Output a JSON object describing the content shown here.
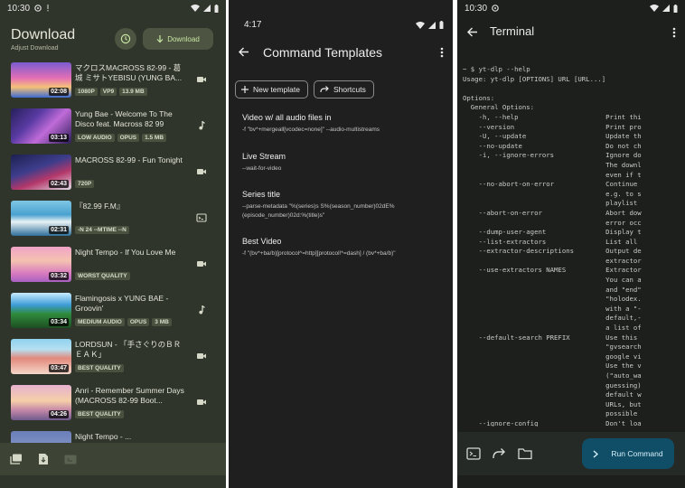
{
  "phone1": {
    "status_time": "10:30",
    "title": "Download",
    "subtitle": "Adjust Download",
    "download_button_label": "Download",
    "items": [
      {
        "title": "マクロスMACROSS 82-99 - 葛城 ミサトYEBISU (YUNG BA...",
        "duration": "02:08",
        "tags": [
          "1080P",
          "VP9",
          "13.9 MB"
        ],
        "type": "video"
      },
      {
        "title": "Yung Bae - Welcome To The Disco feat. Macross 82 99",
        "duration": "03:13",
        "tags": [
          "LOW AUDIO",
          "OPUS",
          "1.5 MB"
        ],
        "type": "audio"
      },
      {
        "title": "MACROSS 82-99 - Fun Tonight",
        "duration": "02:43",
        "tags": [
          "720P"
        ],
        "type": "video"
      },
      {
        "title": "『82.99 F.M』",
        "duration": "02:31",
        "tags": [],
        "subtitle_text": "-N 24 --MTIME --N",
        "type": "command"
      },
      {
        "title": "Night Tempo - If You Love Me",
        "duration": "03:32",
        "tags": [
          "WORST QUALITY"
        ],
        "type": "video"
      },
      {
        "title": "Flamingosis x YUNG BAE - Groovin'",
        "duration": "03:34",
        "tags": [
          "MEDIUM AUDIO",
          "OPUS",
          "3 MB"
        ],
        "type": "audio"
      },
      {
        "title": "LORDSUN - 「手さぐりのＢＲＥＡＫ」",
        "duration": "03:47",
        "tags": [
          "BEST QUALITY"
        ],
        "type": "video"
      },
      {
        "title": "Anri - Remember Summer Days (MACROSS 82-99 Boot...",
        "duration": "04:26",
        "tags": [
          "BEST QUALITY"
        ],
        "type": "video"
      },
      {
        "title": "Night Tempo - ...",
        "duration": "",
        "tags": [],
        "type": "video"
      }
    ]
  },
  "phone2": {
    "status_time": "4:17",
    "title": "Command Templates",
    "new_template_label": "New template",
    "shortcuts_label": "Shortcuts",
    "templates": [
      {
        "title": "Video w/ all audio files in",
        "cmd": "-f \"bv*+mergeall[vcodec=none]\" --audio-multistreams"
      },
      {
        "title": "Live Stream",
        "cmd": "--wait-for-video"
      },
      {
        "title": "Series title",
        "cmd": "--parse-metadata \"%(series)s S%(season_number)02dE%(episode_number)02d:%(title)s\""
      },
      {
        "title": "Best Video",
        "cmd": "-f \"(bv*+ba/b)[protocol^=http][protocol!*=dash] / (bv*+ba/b)\""
      }
    ]
  },
  "phone3": {
    "status_time": "10:30",
    "title": "Terminal",
    "run_button_label": "Run Command",
    "terminal_lines": [
      "~ $ yt-dlp --help",
      "Usage: yt-dlp [OPTIONS] URL [URL...]",
      "",
      "Options:",
      "  General Options:",
      "    -h, --help                      Print thi",
      "    --version                       Print pro",
      "    -U, --update                    Update th",
      "    --no-update                     Do not ch",
      "    -i, --ignore-errors             Ignore do",
      "                                    The downl",
      "                                    even if t",
      "    --no-abort-on-error             Continue ",
      "                                    e.g. to s",
      "                                    playlist ",
      "    --abort-on-error                Abort dow",
      "                                    error occ",
      "    --dump-user-agent               Display t",
      "    --list-extractors               List all ",
      "    --extractor-descriptions        Output de",
      "                                    extractor",
      "    --use-extractors NAMES          Extractor",
      "                                    You can a",
      "                                    and \"end\"",
      "                                    \"holodex.",
      "                                    with a \"-",
      "                                    default,-",
      "                                    a list of",
      "    --default-search PREFIX         Use this ",
      "                                    \"gvsearch",
      "                                    google vi",
      "                                    Use the v",
      "                                    (\"auto_wa",
      "                                    guessing)",
      "                                    default w",
      "                                    URLs, but",
      "                                    possible ",
      "    --ignore-config                 Don't loa"
    ]
  }
}
